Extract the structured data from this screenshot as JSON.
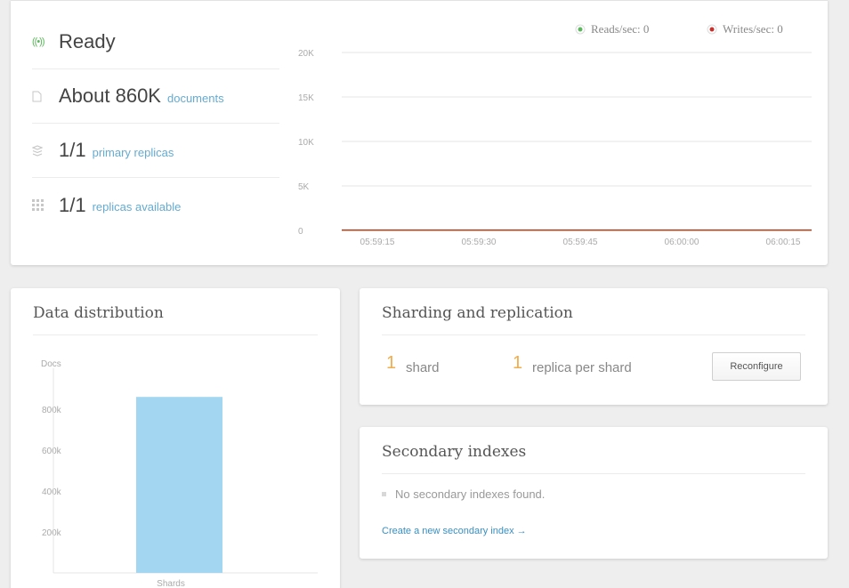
{
  "overview": {
    "status": "Ready",
    "documents_value": "About 860K",
    "documents_label": "documents",
    "primary_value": "1/1",
    "primary_label": "primary replicas",
    "replicas_value": "1/1",
    "replicas_label": "replicas available",
    "icons": [
      "broadcast-icon",
      "document-icon",
      "stack-icon",
      "grid-icon"
    ],
    "colors": {
      "ready": "#5cb85c",
      "accent_link": "#65abd1"
    }
  },
  "io_chart": {
    "legend": [
      {
        "label": "Reads/sec: 0",
        "color": "#5cb85c"
      },
      {
        "label": "Writes/sec: 0",
        "color": "#c9302c"
      }
    ],
    "y_ticks": [
      "20K",
      "15K",
      "10K",
      "5K",
      "0"
    ],
    "x_ticks": [
      "05:59:15",
      "05:59:30",
      "05:59:45",
      "06:00:00",
      "06:00:15"
    ]
  },
  "chart_data": [
    {
      "type": "line",
      "x": [
        "05:59:15",
        "05:59:30",
        "05:59:45",
        "06:00:00",
        "06:00:15"
      ],
      "series": [
        {
          "name": "Reads/sec: 0",
          "values": [
            0,
            0,
            0,
            0,
            0
          ]
        },
        {
          "name": "Writes/sec: 0",
          "values": [
            0,
            0,
            0,
            0,
            0
          ]
        }
      ],
      "ylim": [
        0,
        20000
      ],
      "grid": true,
      "legend": "top-right"
    },
    {
      "type": "bar",
      "categories": [
        "Shards"
      ],
      "values": [
        860000
      ],
      "ylabel": "Docs",
      "ylim": [
        0,
        1000000
      ],
      "y_ticks": [
        "200k",
        "400k",
        "600k",
        "800k"
      ],
      "color": "#a3d6f0"
    }
  ],
  "distribution": {
    "title": "Data distribution",
    "ylabel": "Docs",
    "y_ticks": [
      "200k",
      "400k",
      "600k",
      "800k"
    ],
    "category": "Shards"
  },
  "sharding": {
    "title": "Sharding and replication",
    "shards_value": "1",
    "shards_label": "shard",
    "replicas_value": "1",
    "replicas_label": "replica per shard",
    "reconfigure_label": "Reconfigure"
  },
  "indexes": {
    "title": "Secondary indexes",
    "empty_text": "No secondary indexes found.",
    "create_link": "Create a new secondary index →"
  }
}
